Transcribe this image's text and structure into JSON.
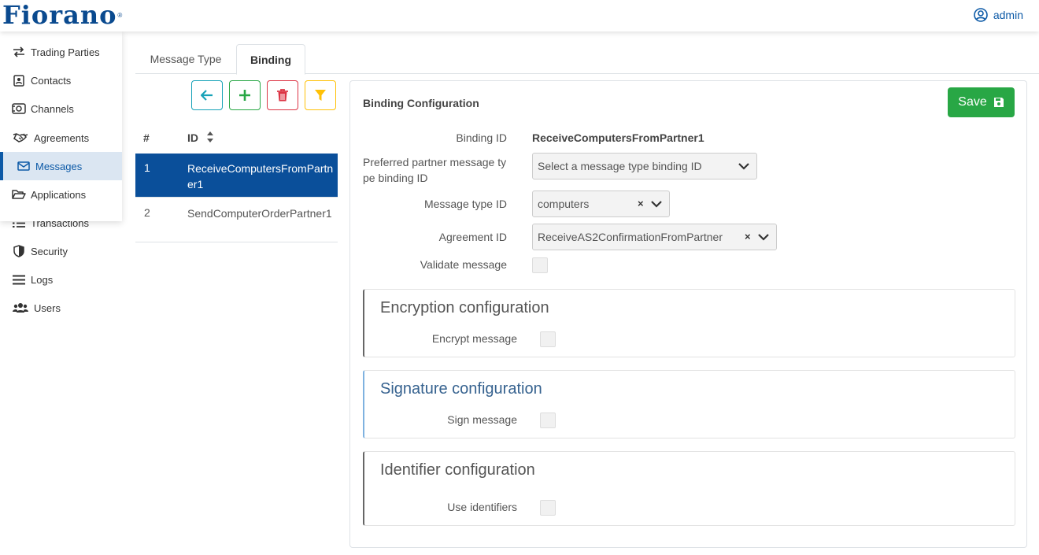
{
  "brand": {
    "logo_text": "Fiorano",
    "logo_mark": "®"
  },
  "user": {
    "name": "admin",
    "icon": "user-circle-icon"
  },
  "sidebar": {
    "items": [
      {
        "label": "Trading Parties",
        "icon": "arrows-exchange-icon"
      },
      {
        "label": "Contacts",
        "icon": "contact-card-icon"
      },
      {
        "label": "Channels",
        "icon": "channel-icon"
      },
      {
        "label": "Agreements",
        "icon": "handshake-icon"
      },
      {
        "label": "Messages",
        "icon": "envelope-icon",
        "active": true
      },
      {
        "label": "Applications",
        "icon": "folder-open-icon"
      },
      {
        "label": "Transactions",
        "icon": "list-icon"
      },
      {
        "label": "Security",
        "icon": "shield-icon"
      },
      {
        "label": "Logs",
        "icon": "bars-icon"
      },
      {
        "label": "Users",
        "icon": "users-icon"
      }
    ]
  },
  "tabs": [
    {
      "label": "Message Type",
      "active": false
    },
    {
      "label": "Binding",
      "active": true
    }
  ],
  "toolbar": {
    "back_icon": "arrow-left-icon",
    "add_icon": "plus-icon",
    "delete_icon": "trash-icon",
    "filter_icon": "filter-icon",
    "colors": {
      "back": "#17a2b8",
      "add": "#28a745",
      "delete": "#dc3545",
      "filter": "#ffc107"
    }
  },
  "table": {
    "headers": {
      "num": "#",
      "id": "ID"
    },
    "rows": [
      {
        "num": "1",
        "id": "ReceiveComputersFromPartner1",
        "selected": true
      },
      {
        "num": "2",
        "id": "SendComputerOrderPartner1",
        "selected": false
      }
    ]
  },
  "config": {
    "title": "Binding Configuration",
    "save_label": "Save",
    "binding_id_label": "Binding ID",
    "binding_id_value": "ReceiveComputersFromPartner1",
    "preferred_label": "Preferred partner message type binding ID",
    "preferred_placeholder": "Select a message type binding ID",
    "message_type_label": "Message type ID",
    "message_type_value": "computers",
    "agreement_label": "Agreement ID",
    "agreement_value": "ReceiveAS2ConfirmationFromPartner",
    "validate_label": "Validate message",
    "clear_glyph": "×",
    "sections": {
      "encryption": {
        "title": "Encryption configuration",
        "field_label": "Encrypt message"
      },
      "signature": {
        "title": "Signature configuration",
        "field_label": "Sign message"
      },
      "identifier": {
        "title": "Identifier configuration",
        "field_label": "Use identifiers"
      }
    }
  },
  "colors": {
    "primary": "#0d5aa7",
    "selected_row": "#0a4f9a",
    "save": "#28a745"
  }
}
